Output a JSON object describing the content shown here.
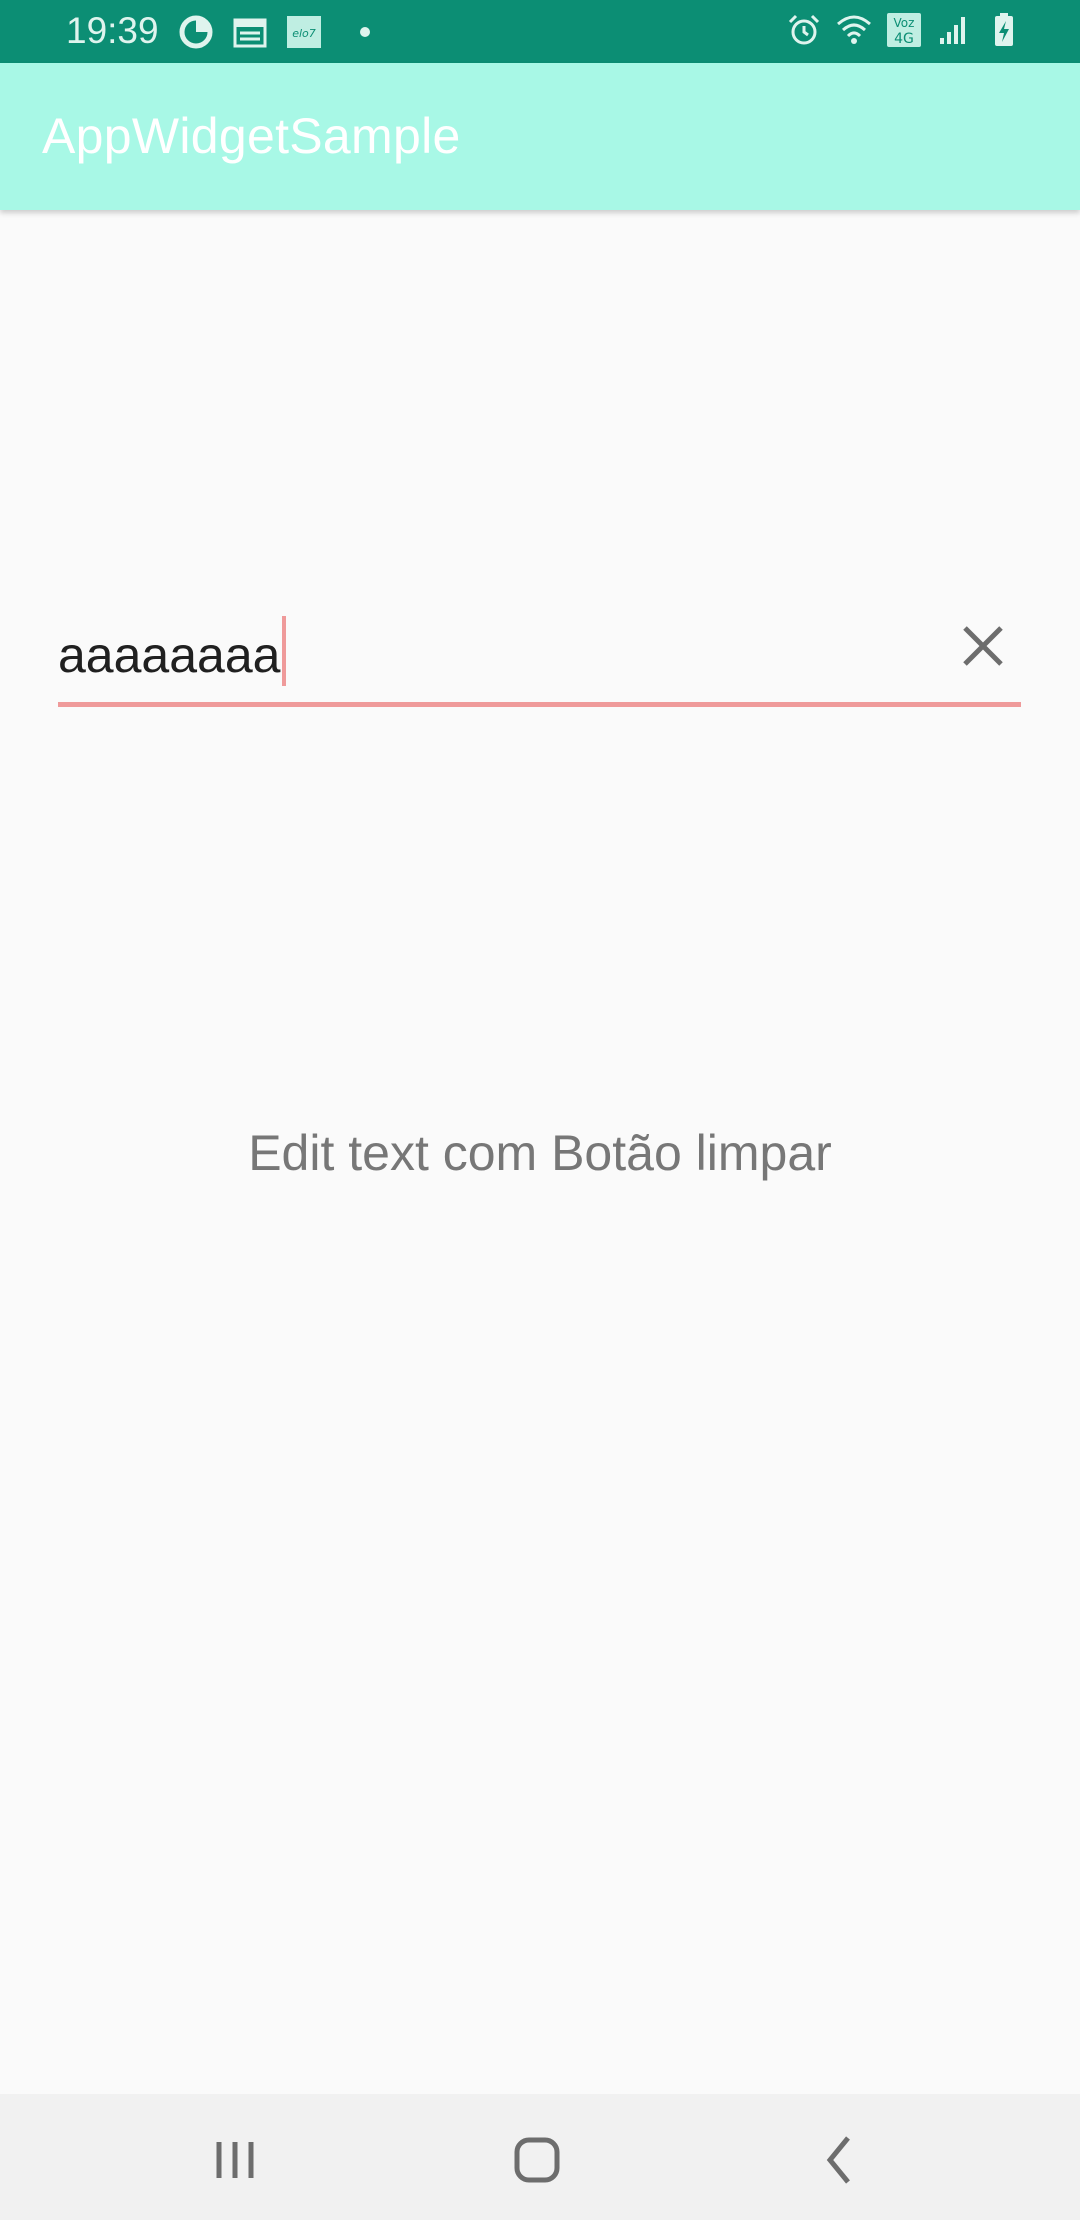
{
  "status_bar": {
    "time": "19:39",
    "left_icons": [
      "data-saver-icon",
      "calendar-icon",
      "elo7-icon",
      "notification-dot-icon"
    ],
    "right_icons": [
      "alarm-icon",
      "wifi-icon",
      "volte-4g-icon",
      "signal-icon",
      "battery-charging-icon"
    ],
    "network_label_top": "Voz",
    "network_label_bottom": "4G",
    "app_notification_label": "elo7"
  },
  "app_bar": {
    "title": "AppWidgetSample",
    "color": "#a8f8e6"
  },
  "edit_text": {
    "value": "aaaaaaaa",
    "clear_icon": "close-icon",
    "accent_color": "#ef9a9a"
  },
  "main": {
    "label": "Edit text com Botão limpar"
  },
  "nav_bar": {
    "buttons": [
      "recents-icon",
      "home-icon",
      "back-icon"
    ]
  }
}
